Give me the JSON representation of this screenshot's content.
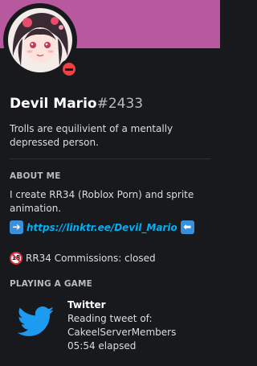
{
  "profile": {
    "username": "Devil Mario",
    "discriminator": "#2433",
    "status": "dnd",
    "custom_status": "Trolls are equilivient of a mentally depressed person.",
    "banner_color": "#b8589e"
  },
  "about": {
    "title": "ABOUT ME",
    "text": "I create RR34 (Roblox Porn) and sprite animation.",
    "link_text": "https://linktr.ee/Devil_Mario",
    "commissions_text": "RR34 Commissions: closed",
    "age_badge_text": "18"
  },
  "activity": {
    "section_title": "PLAYING A GAME",
    "name": "Twitter",
    "details": "Reading tweet of:",
    "state": "CakeelServerMembers",
    "elapsed": "05:54 elapsed",
    "icon": "twitter-bird-icon"
  }
}
